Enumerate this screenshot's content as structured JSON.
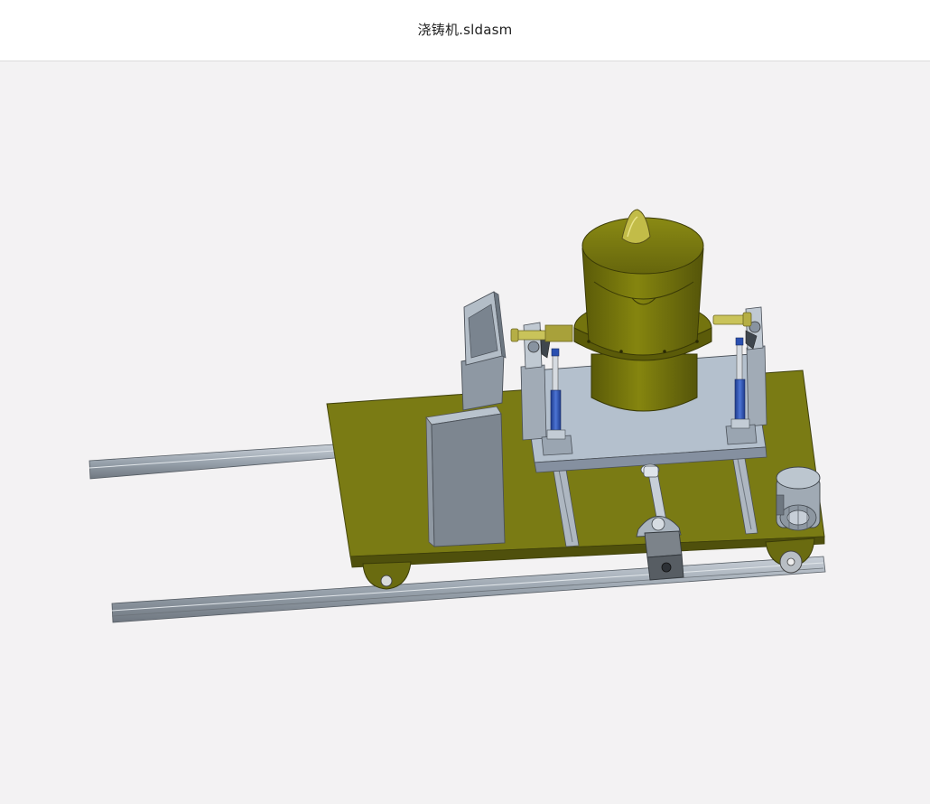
{
  "window": {
    "title": "浇铸机.sldasm"
  },
  "viewport": {
    "background": "#f3f2f3",
    "model_colors": {
      "base_plate": "#7a7b14",
      "crucible": "#6e6e0c",
      "steel": "#a7b1bd",
      "rail": "#9ca6b1",
      "cylinder_blue": "#2a4fb0",
      "brass": "#c9c35a"
    }
  }
}
